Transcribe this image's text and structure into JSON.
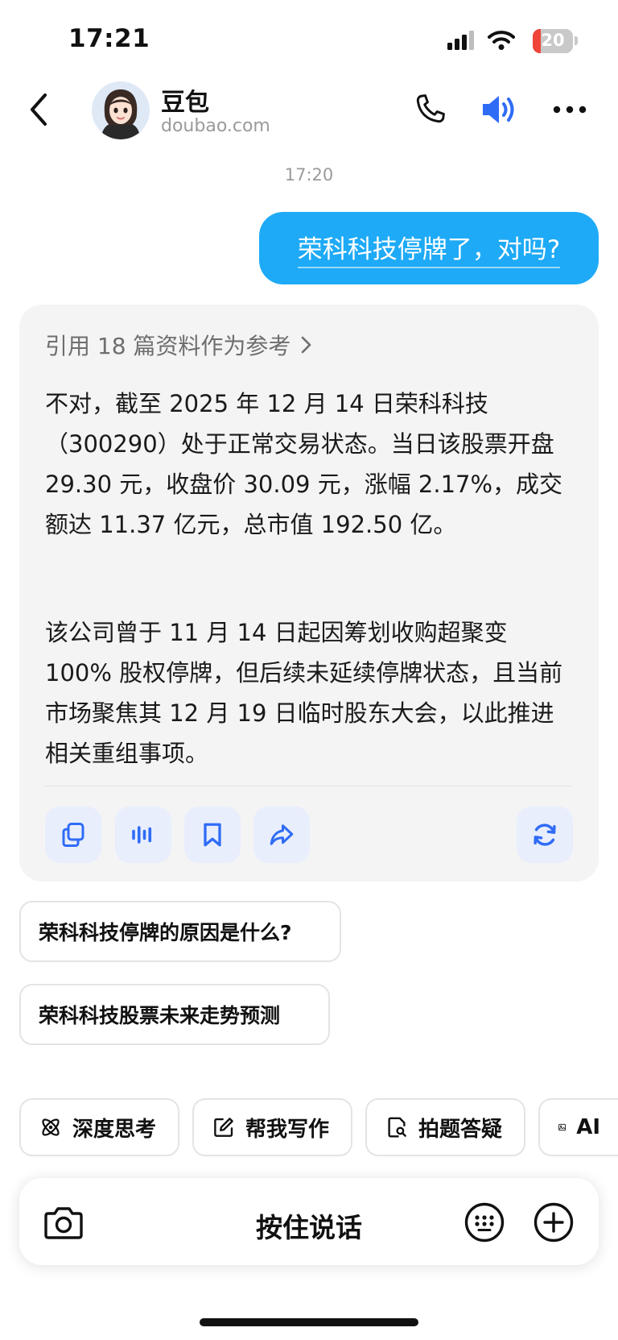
{
  "status_bar": {
    "time": "17:21",
    "battery_level": "20",
    "battery_fill": 0.2,
    "icons": [
      "signal-icon",
      "wifi-icon",
      "battery-icon"
    ]
  },
  "header": {
    "name": "豆包",
    "domain": "doubao.com",
    "icons": [
      "back-icon",
      "avatar",
      "phone-icon",
      "speaker-icon",
      "more-icon"
    ]
  },
  "chat": {
    "timestamp": "17:20",
    "user_message": "荣科科技停牌了，对吗?",
    "references": "引用 18 篇资料作为参考",
    "answer_paragraphs": [
      "不对，截至 2025 年 12 月 14 日荣科科技（300290）处于正常交易状态。当日该股票开盘 29.30 元，收盘价 30.09 元，涨幅 2.17%，成交额达 11.37 亿元，总市值 192.50 亿。",
      "该公司曾于 11 月 14 日起因筹划收购超聚变 100% 股权停牌，但后续未延续停牌状态，且当前市场聚焦其 12 月 19 日临时股东大会，以此推进相关重组事项。"
    ],
    "answer_actions": [
      "copy-icon",
      "voice-icon",
      "bookmark-icon",
      "share-icon",
      "regenerate-icon"
    ]
  },
  "suggestions": [
    "荣科科技停牌的原因是什么?",
    "荣科科技股票未来走势预测"
  ],
  "tools": [
    {
      "label": "深度思考",
      "icon": "atom-icon"
    },
    {
      "label": "帮我写作",
      "icon": "edit-icon"
    },
    {
      "label": "拍题答疑",
      "icon": "doc-search-icon"
    },
    {
      "label": "AI",
      "icon": "image-icon"
    }
  ],
  "input": {
    "hold_to_talk": "按住说话",
    "icons": [
      "camera-icon",
      "keyboard-icon",
      "plus-icon"
    ]
  },
  "colors": {
    "accent": "#1eaaf6",
    "card_bg": "#f4f4f5",
    "action_bg": "#e8eefc",
    "action_icon": "#2f6cf6",
    "battery_low": "#f04438"
  }
}
